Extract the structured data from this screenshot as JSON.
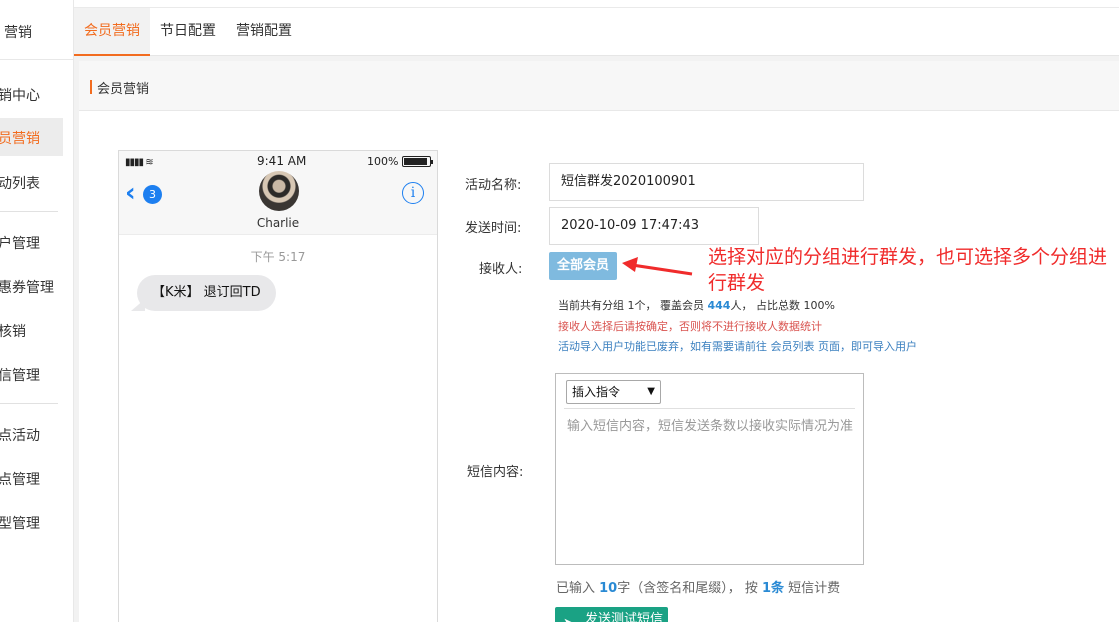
{
  "sidebar": {
    "header": "营销",
    "items": [
      {
        "label": "销中心",
        "active": false
      },
      {
        "label": "员营销",
        "active": true
      },
      {
        "label": "动列表",
        "active": false
      },
      {
        "label": "户管理",
        "active": false
      },
      {
        "label": "惠券管理",
        "active": false
      },
      {
        "label": "核销",
        "active": false
      },
      {
        "label": "信管理",
        "active": false
      },
      {
        "label": "点活动",
        "active": false
      },
      {
        "label": "点管理",
        "active": false
      },
      {
        "label": "型管理",
        "active": false
      }
    ]
  },
  "tabs": [
    {
      "label": "会员营销",
      "active": true
    },
    {
      "label": "节日配置",
      "active": false
    },
    {
      "label": "营销配置",
      "active": false
    }
  ],
  "panel": {
    "title": "会员营销"
  },
  "phone": {
    "signal": "▮▮▮▮ ≋",
    "time": "9:41 AM",
    "battery": "100%",
    "back_count": "3",
    "contact": "Charlie",
    "message_time": "下午 5:17",
    "message": "【K米】 退订回TD"
  },
  "form": {
    "activity_name_label": "活动名称:",
    "activity_name_value": "短信群发2020100901",
    "send_time_label": "发送时间:",
    "send_time_value": "2020-10-09 17:47:43",
    "receiver_label": "接收人:",
    "receiver_button": "全部会员",
    "summary_prefix": "当前共有分组 1个， 覆盖会员 ",
    "summary_members": "444",
    "summary_suffix": "人， 占比总数 100%",
    "warning": "接收人选择后请按确定，否则将不进行接收人数据统计",
    "notice": "活动导入用户功能已废弃，如有需要请前往 会员列表 页面，即可导入用户",
    "content_label": "短信内容:",
    "insert_select": "插入指令",
    "content_placeholder": "输入短信内容，短信发送条数以接收实际情况为准",
    "count_prefix": "已输入 ",
    "count_chars": "10",
    "count_mid": "字（含签名和尾缀）， 按 ",
    "count_messages": "1条",
    "count_suffix": " 短信计费",
    "send_test_button": "发送测试短信"
  },
  "annotation": "选择对应的分组进行群发，也可选择多个分组进行群发",
  "colors": {
    "accent": "#f26c1f",
    "link": "#2a8ad4",
    "warning": "#d9534f",
    "annotation": "#f02b2b",
    "send_button": "#1aa284"
  }
}
